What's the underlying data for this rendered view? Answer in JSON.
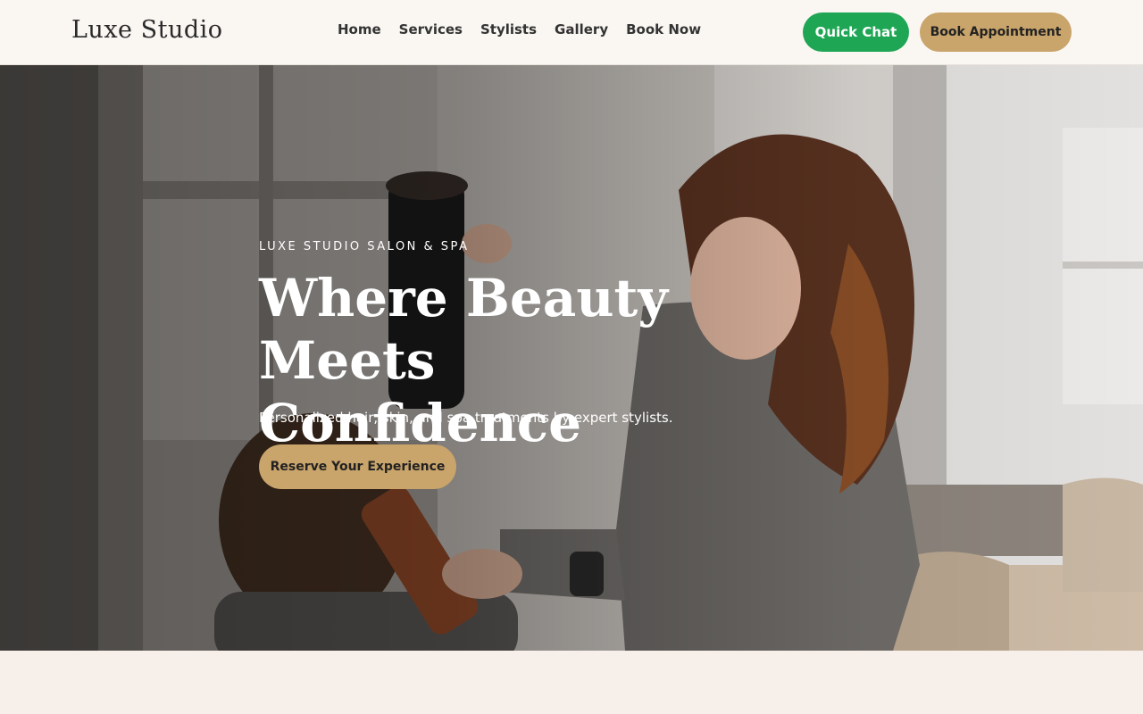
{
  "header": {
    "logo": "Luxe Studio",
    "nav": [
      "Home",
      "Services",
      "Stylists",
      "Gallery",
      "Book Now"
    ],
    "quick_chat_label": "Quick Chat",
    "book_label": "Book Appointment"
  },
  "hero": {
    "eyebrow": "LUXE STUDIO SALON & SPA",
    "headline": "Where Beauty Meets Confidence",
    "subline": "Personalized hair, skin, and spa treatments by expert stylists.",
    "cta_label": "Reserve Your Experience"
  },
  "colors": {
    "accent_gold": "#c9a46b",
    "chat_green": "#1fa654",
    "header_bg": "#faf7f3",
    "page_bg": "#f7efea"
  }
}
